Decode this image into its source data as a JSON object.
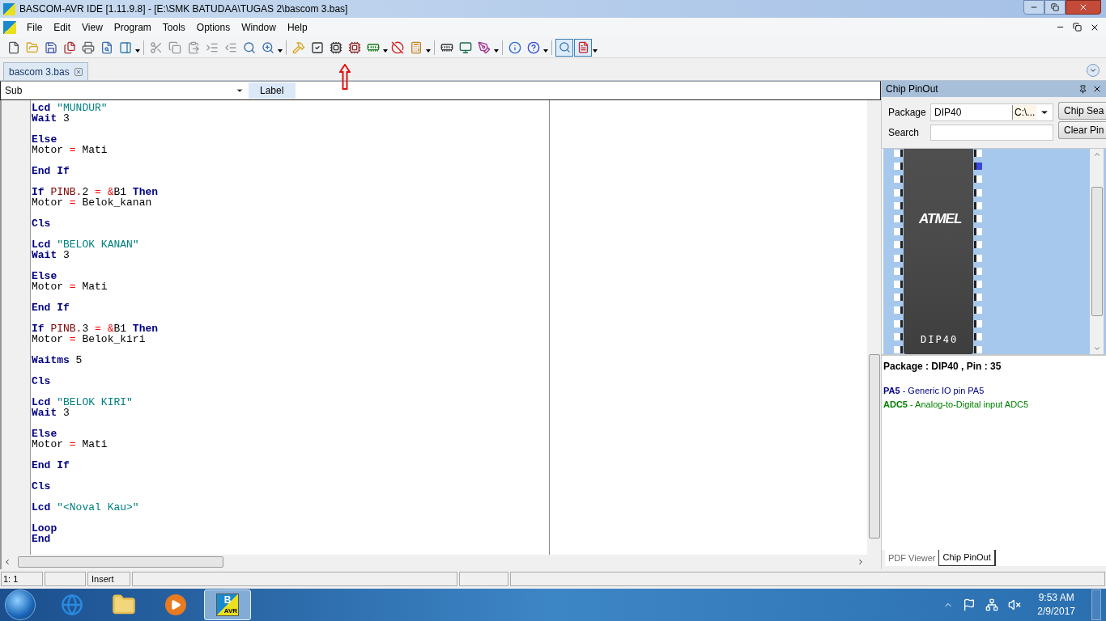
{
  "window": {
    "title": "BASCOM-AVR IDE [1.11.9.8] - [E:\\SMK BATUDAA\\TUGAS 2\\bascom 3.bas]"
  },
  "menu": [
    "File",
    "Edit",
    "View",
    "Program",
    "Tools",
    "Options",
    "Window",
    "Help"
  ],
  "toolbar": {
    "view_toggles": [
      {
        "pressed": true
      },
      {
        "pressed": true
      }
    ]
  },
  "editor_tabs": [
    {
      "label": "bascom 3.bas",
      "selected": true
    }
  ],
  "navigation_bar": {
    "sub_label": "Sub",
    "label_label": "Label"
  },
  "code": [
    {
      "kind": "code",
      "tokens": [
        {
          "kind": "kw",
          "text": "Lcd "
        },
        {
          "kind": "str",
          "text": "\"MUNDUR\""
        }
      ]
    },
    {
      "kind": "code",
      "tokens": [
        {
          "kind": "kw",
          "text": "Wait "
        },
        {
          "kind": "plain",
          "text": "3"
        }
      ]
    },
    {
      "kind": "blank"
    },
    {
      "kind": "code",
      "tokens": [
        {
          "kind": "kw",
          "text": "Else"
        }
      ]
    },
    {
      "kind": "code",
      "tokens": [
        {
          "kind": "plain",
          "text": "Motor "
        },
        {
          "kind": "op",
          "text": "= "
        },
        {
          "kind": "plain",
          "text": "Mati"
        }
      ]
    },
    {
      "kind": "blank"
    },
    {
      "kind": "code",
      "tokens": [
        {
          "kind": "kw",
          "text": "End If"
        }
      ]
    },
    {
      "kind": "blank"
    },
    {
      "kind": "code",
      "tokens": [
        {
          "kind": "kw",
          "text": "If "
        },
        {
          "kind": "reg",
          "text": "PINB."
        },
        {
          "kind": "plain",
          "text": "2 "
        },
        {
          "kind": "op",
          "text": "= &"
        },
        {
          "kind": "plain",
          "text": "B1 "
        },
        {
          "kind": "kw",
          "text": "Then"
        }
      ]
    },
    {
      "kind": "code",
      "tokens": [
        {
          "kind": "plain",
          "text": "Motor "
        },
        {
          "kind": "op",
          "text": "= "
        },
        {
          "kind": "plain",
          "text": "Belok_kanan"
        }
      ]
    },
    {
      "kind": "blank"
    },
    {
      "kind": "code",
      "tokens": [
        {
          "kind": "kw",
          "text": "Cls"
        }
      ]
    },
    {
      "kind": "blank"
    },
    {
      "kind": "code",
      "tokens": [
        {
          "kind": "kw",
          "text": "Lcd "
        },
        {
          "kind": "str",
          "text": "\"BELOK KANAN\""
        }
      ]
    },
    {
      "kind": "code",
      "tokens": [
        {
          "kind": "kw",
          "text": "Wait "
        },
        {
          "kind": "plain",
          "text": "3"
        }
      ]
    },
    {
      "kind": "blank"
    },
    {
      "kind": "code",
      "tokens": [
        {
          "kind": "kw",
          "text": "Else"
        }
      ]
    },
    {
      "kind": "code",
      "tokens": [
        {
          "kind": "plain",
          "text": "Motor "
        },
        {
          "kind": "op",
          "text": "= "
        },
        {
          "kind": "plain",
          "text": "Mati"
        }
      ]
    },
    {
      "kind": "blank"
    },
    {
      "kind": "code",
      "tokens": [
        {
          "kind": "kw",
          "text": "End If"
        }
      ]
    },
    {
      "kind": "blank"
    },
    {
      "kind": "code",
      "tokens": [
        {
          "kind": "kw",
          "text": "If "
        },
        {
          "kind": "reg",
          "text": "PINB."
        },
        {
          "kind": "plain",
          "text": "3 "
        },
        {
          "kind": "op",
          "text": "= &"
        },
        {
          "kind": "plain",
          "text": "B1 "
        },
        {
          "kind": "kw",
          "text": "Then"
        }
      ]
    },
    {
      "kind": "code",
      "tokens": [
        {
          "kind": "plain",
          "text": "Motor "
        },
        {
          "kind": "op",
          "text": "= "
        },
        {
          "kind": "plain",
          "text": "Belok_kiri"
        }
      ]
    },
    {
      "kind": "blank"
    },
    {
      "kind": "code",
      "tokens": [
        {
          "kind": "kw",
          "text": "Waitms "
        },
        {
          "kind": "plain",
          "text": "5"
        }
      ]
    },
    {
      "kind": "blank"
    },
    {
      "kind": "code",
      "tokens": [
        {
          "kind": "kw",
          "text": "Cls"
        }
      ]
    },
    {
      "kind": "blank"
    },
    {
      "kind": "code",
      "tokens": [
        {
          "kind": "kw",
          "text": "Lcd "
        },
        {
          "kind": "str",
          "text": "\"BELOK KIRI\""
        }
      ]
    },
    {
      "kind": "code",
      "tokens": [
        {
          "kind": "kw",
          "text": "Wait "
        },
        {
          "kind": "plain",
          "text": "3"
        }
      ]
    },
    {
      "kind": "blank"
    },
    {
      "kind": "code",
      "tokens": [
        {
          "kind": "kw",
          "text": "Else"
        }
      ]
    },
    {
      "kind": "code",
      "tokens": [
        {
          "kind": "plain",
          "text": "Motor "
        },
        {
          "kind": "op",
          "text": "= "
        },
        {
          "kind": "plain",
          "text": "Mati"
        }
      ]
    },
    {
      "kind": "blank"
    },
    {
      "kind": "code",
      "tokens": [
        {
          "kind": "kw",
          "text": "End If"
        }
      ]
    },
    {
      "kind": "blank"
    },
    {
      "kind": "code",
      "tokens": [
        {
          "kind": "kw",
          "text": "Cls"
        }
      ]
    },
    {
      "kind": "blank"
    },
    {
      "kind": "code",
      "tokens": [
        {
          "kind": "kw",
          "text": "Lcd "
        },
        {
          "kind": "str",
          "text": "\"<Noval Kau>\""
        }
      ]
    },
    {
      "kind": "blank"
    },
    {
      "kind": "code",
      "tokens": [
        {
          "kind": "kw",
          "text": "Loop"
        }
      ]
    },
    {
      "kind": "code",
      "tokens": [
        {
          "kind": "kw",
          "text": "End"
        }
      ]
    }
  ],
  "chip_pinout": {
    "title": "Chip PinOut",
    "package_label": "Package",
    "package_value": "DIP40",
    "package_path": "C:\\...",
    "search_label": "Search",
    "buttons": [
      "Chip Sea",
      "Clear Pin"
    ],
    "chip": {
      "logo": "ATMEL",
      "label": "DIP40",
      "right_pins": [
        {
          "selected": false
        },
        {
          "selected": true
        },
        {
          "selected": false
        },
        {
          "selected": false
        },
        {
          "selected": false
        },
        {
          "selected": false
        },
        {
          "selected": false
        },
        {
          "selected": false
        },
        {
          "selected": false
        },
        {
          "selected": false
        },
        {
          "selected": false
        },
        {
          "selected": false
        },
        {
          "selected": false
        },
        {
          "selected": false
        },
        {
          "selected": false
        },
        {
          "selected": false
        }
      ]
    },
    "pin_header": "Package : DIP40 , Pin : 35",
    "functions": [
      {
        "text": "**PA5** - Generic IO pin PA5",
        "color": "#000080"
      },
      {
        "text": "**ADC5** - Analog-to-Digital input ADC5",
        "color": "#008000"
      }
    ]
  },
  "panel_tabs": [
    {
      "label": "PDF Viewer",
      "selected": false
    },
    {
      "label": "Chip PinOut",
      "selected": true
    }
  ],
  "status_bar": {
    "position": "1: 1",
    "mode": "Insert"
  },
  "taskbar": {
    "apps": [
      {
        "kind": "browser",
        "selected": false
      },
      {
        "kind": "folder",
        "selected": false
      },
      {
        "kind": "media",
        "selected": false
      },
      {
        "kind": "bascom",
        "selected": true,
        "icon_text": "B",
        "icon_subtext": "AVR"
      }
    ],
    "time": "9:53 AM",
    "date": "2/9/2017"
  }
}
